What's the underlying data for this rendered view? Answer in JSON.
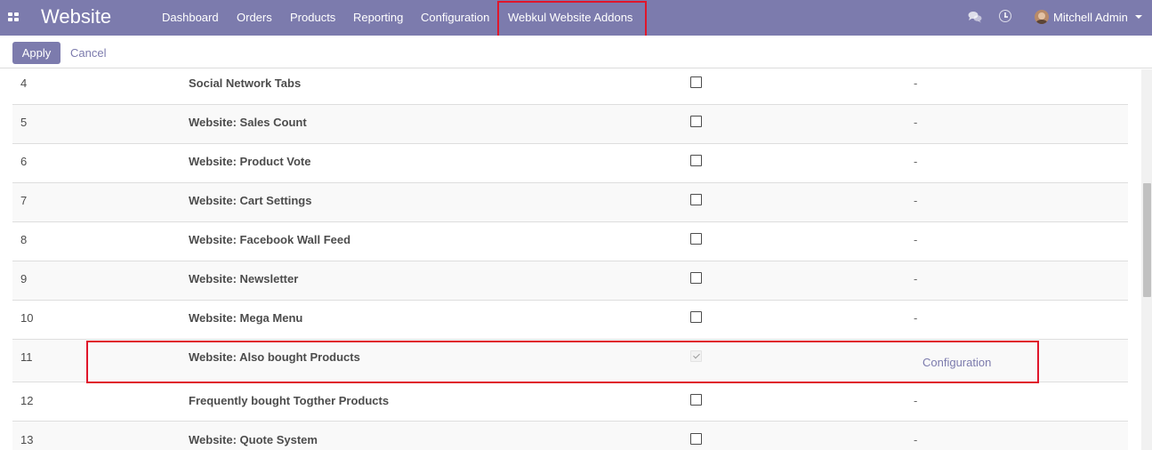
{
  "app": {
    "title": "Website"
  },
  "nav": {
    "items": [
      "Dashboard",
      "Orders",
      "Products",
      "Reporting",
      "Configuration",
      "Webkul Website Addons"
    ],
    "highlighted_index": 5,
    "highlight_color": "#e0162b"
  },
  "user": {
    "name": "Mitchell Admin"
  },
  "icons": {
    "apps": "apps-grid-icon",
    "chat": "chat-bubbles-icon",
    "clock": "clock-icon",
    "caret": "caret-down-icon"
  },
  "controls": {
    "apply_label": "Apply",
    "cancel_label": "Cancel"
  },
  "theme": {
    "primary": "#7c7bad",
    "text": "#4c4c4c",
    "highlight": "#e0162b"
  },
  "rows": [
    {
      "num": "4",
      "name": "Social Network Tabs",
      "checked": false,
      "action": "-"
    },
    {
      "num": "5",
      "name": "Website: Sales Count",
      "checked": false,
      "action": "-"
    },
    {
      "num": "6",
      "name": "Website: Product Vote",
      "checked": false,
      "action": "-"
    },
    {
      "num": "7",
      "name": "Website: Cart Settings",
      "checked": false,
      "action": "-"
    },
    {
      "num": "8",
      "name": "Website: Facebook Wall Feed",
      "checked": false,
      "action": "-"
    },
    {
      "num": "9",
      "name": "Website: Newsletter",
      "checked": false,
      "action": "-"
    },
    {
      "num": "10",
      "name": "Website: Mega Menu",
      "checked": false,
      "action": "-"
    },
    {
      "num": "11",
      "name": "Website: Also bought Products",
      "checked": true,
      "action": "Configuration",
      "highlighted": true
    },
    {
      "num": "12",
      "name": "Frequently bought Togther Products",
      "checked": false,
      "action": "-"
    },
    {
      "num": "13",
      "name": "Website: Quote System",
      "checked": false,
      "action": "-"
    }
  ]
}
